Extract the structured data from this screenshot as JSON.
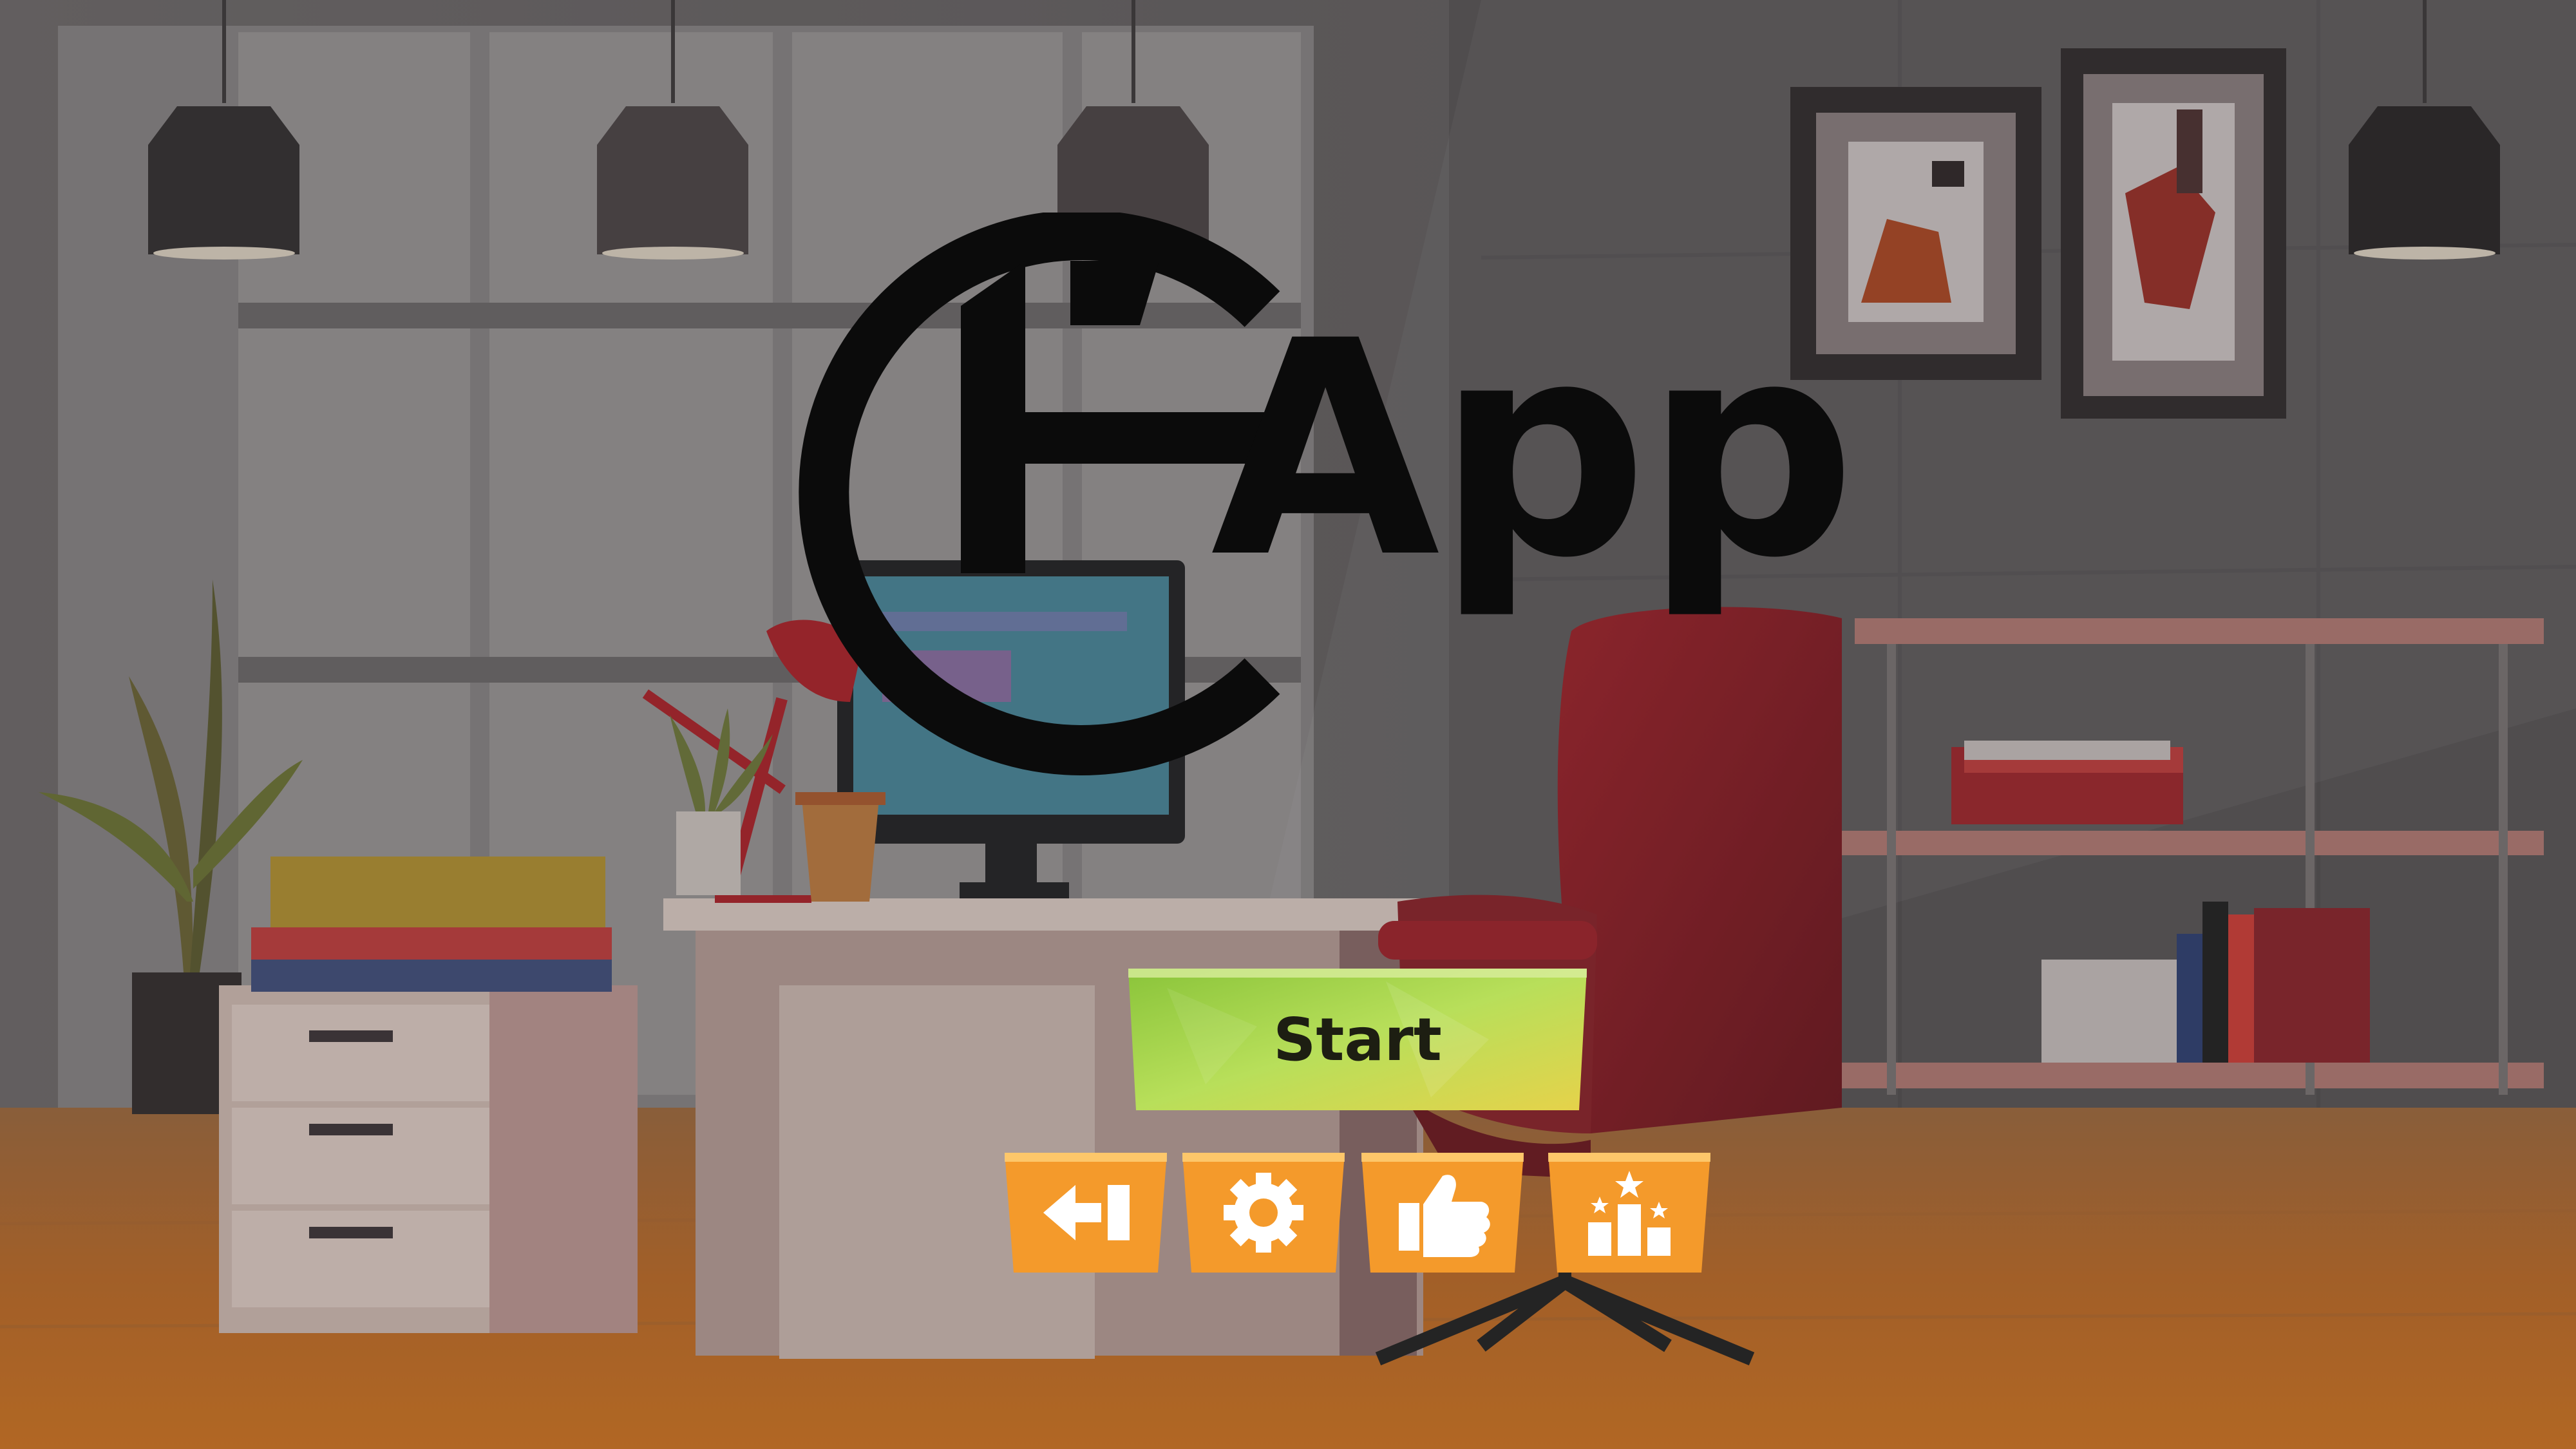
{
  "app": {
    "logo_text": "App"
  },
  "menu": {
    "start_label": "Start",
    "icons": [
      {
        "name": "exit-icon"
      },
      {
        "name": "gear-icon"
      },
      {
        "name": "thumbs-up-icon"
      },
      {
        "name": "leaderboard-icon"
      }
    ]
  },
  "colors": {
    "start_button": "#a9d34a",
    "icon_button": "#f49a2b",
    "logo": "#0b0b0b"
  }
}
